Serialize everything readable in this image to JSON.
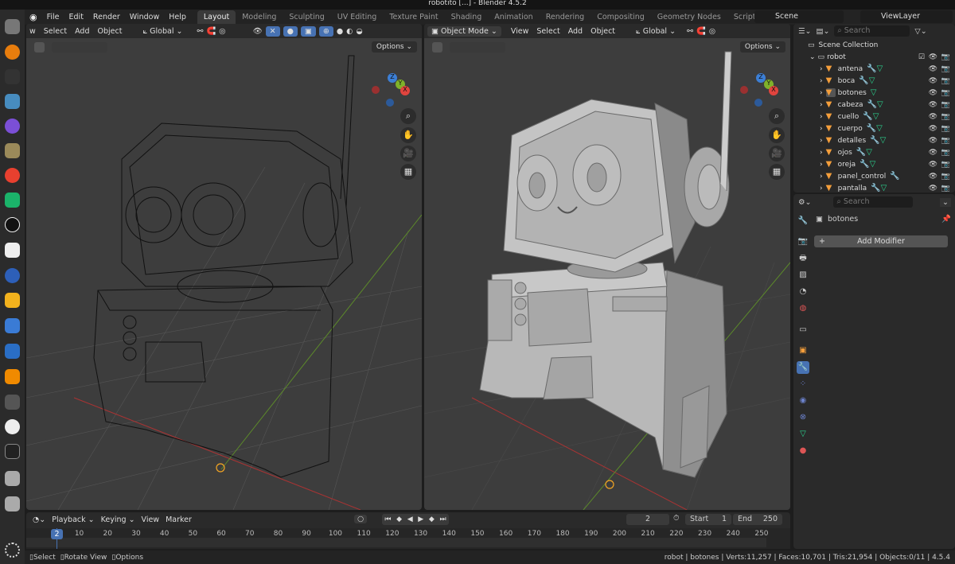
{
  "title": "robotito [...] - Blender 4.5.2",
  "menu": {
    "items": [
      "File",
      "Edit",
      "Render",
      "Window",
      "Help"
    ]
  },
  "workspaces": [
    "Layout",
    "Modeling",
    "Sculpting",
    "UV Editing",
    "Texture Paint",
    "Shading",
    "Animation",
    "Rendering",
    "Compositing",
    "Geometry Nodes",
    "Scripting",
    "+"
  ],
  "scene": "Scene",
  "view_layer": "ViewLayer",
  "left_viewport": {
    "menus": [
      "w",
      "Select",
      "Add",
      "Object"
    ],
    "orientation": "Global",
    "options": "Options",
    "shading": "wireframe"
  },
  "right_viewport": {
    "mode": "Object Mode",
    "menus": [
      "View",
      "Select",
      "Add",
      "Object"
    ],
    "orientation": "Global",
    "options": "Options",
    "shading": "solid"
  },
  "gizmo": {
    "x": "X",
    "y": "Y",
    "z": "Z"
  },
  "outliner": {
    "search_placeholder": "Search",
    "root": "Scene Collection",
    "collection": "robot",
    "items": [
      {
        "name": "antena",
        "modifier": true,
        "mesh": true
      },
      {
        "name": "boca",
        "modifier": true,
        "mesh": true
      },
      {
        "name": "botones",
        "modifier": false,
        "mesh": true,
        "active": true
      },
      {
        "name": "cabeza",
        "modifier": true,
        "mesh": true
      },
      {
        "name": "cuello",
        "modifier": true,
        "mesh": true
      },
      {
        "name": "cuerpo",
        "modifier": true,
        "mesh": true
      },
      {
        "name": "detalles",
        "modifier": true,
        "mesh": true
      },
      {
        "name": "ojos",
        "modifier": true,
        "mesh": true
      },
      {
        "name": "oreja",
        "modifier": true,
        "mesh": true
      },
      {
        "name": "panel_control",
        "modifier": true,
        "mesh": false
      },
      {
        "name": "pantalla",
        "modifier": true,
        "mesh": true
      }
    ]
  },
  "properties": {
    "search_placeholder": "Search",
    "object": "botones",
    "add_modifier": "Add Modifier"
  },
  "timeline": {
    "menus": [
      "Playback",
      "Keying",
      "View",
      "Marker"
    ],
    "current_frame": "2",
    "start_label": "Start",
    "start": "1",
    "end_label": "End",
    "end": "250",
    "ticks": [
      "10",
      "20",
      "30",
      "40",
      "50",
      "60",
      "70",
      "80",
      "90",
      "100",
      "110",
      "120",
      "130",
      "140",
      "150",
      "160",
      "170",
      "180",
      "190",
      "200",
      "210",
      "220",
      "230",
      "240",
      "250"
    ]
  },
  "statusbar": {
    "hints": [
      "Select",
      "Rotate View",
      "Options"
    ],
    "info": "robot | botones | Verts:11,257 | Faces:10,701 | Tris:21,954 | Objects:0/11 | 4.5.4"
  },
  "colors": {
    "accent": "#4772b3",
    "object_orange": "#f49e3b",
    "mesh_green": "#2bd48f",
    "modifier_blue": "#6c82cc",
    "viewport_bg": "#3d3d3d"
  }
}
